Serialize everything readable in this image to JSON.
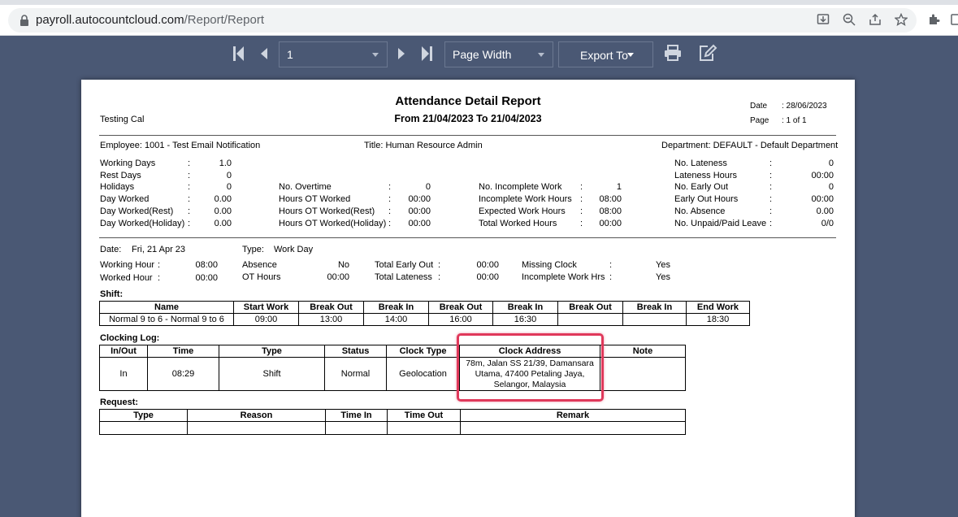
{
  "browser": {
    "url_host": "payroll.autocountcloud.com",
    "url_path": "/Report/Report"
  },
  "toolbar": {
    "page_value": "1",
    "zoom_value": "Page Width",
    "export_label": "Export To"
  },
  "report": {
    "title": "Attendance Detail Report",
    "subtitle": "From 21/04/2023 To 21/04/2023",
    "company": "Testing Cal",
    "date_label": "Date",
    "date_value": ": 28/06/2023",
    "page_label": "Page",
    "page_value": ": 1 of 1",
    "employee": "Employee:  1001 - Test Email Notification",
    "title_field": "Title: Human Resource Admin",
    "department": "Department: DEFAULT - Default Department",
    "summary_col1": [
      {
        "label": "Working Days",
        "value": "1.0"
      },
      {
        "label": "Rest Days",
        "value": "0"
      },
      {
        "label": "Holidays",
        "value": "0"
      },
      {
        "label": "Day Worked",
        "value": "0.00"
      },
      {
        "label": "Day Worked(Rest)",
        "value": "0.00"
      },
      {
        "label": "Day Worked(Holiday)",
        "value": "0.00"
      }
    ],
    "summary_col2": [
      {
        "label": "No. Overtime",
        "value": "0"
      },
      {
        "label": "Hours OT Worked",
        "value": "00:00"
      },
      {
        "label": "Hours OT Worked(Rest)",
        "value": "00:00"
      },
      {
        "label": "Hours OT Worked(Holiday)",
        "value": "00:00"
      }
    ],
    "summary_col3": [
      {
        "label": "No. Incomplete Work",
        "value": "1"
      },
      {
        "label": "Incomplete Work Hours",
        "value": "08:00"
      },
      {
        "label": "Expected Work Hours",
        "value": "08:00"
      },
      {
        "label": "Total Worked Hours",
        "value": "00:00"
      }
    ],
    "summary_col4": [
      {
        "label": "No. Lateness",
        "value": "0"
      },
      {
        "label": "Lateness Hours",
        "value": "00:00"
      },
      {
        "label": "No. Early Out",
        "value": "0"
      },
      {
        "label": "Early Out Hours",
        "value": "00:00"
      },
      {
        "label": "No. Absence",
        "value": "0.00"
      },
      {
        "label": "No. Unpaid/Paid Leave",
        "value": "0/0"
      }
    ],
    "day": {
      "date_label": "Date:",
      "date_value": "Fri, 21 Apr 23",
      "type_label": "Type:",
      "type_value": "Work Day",
      "working_hour_label": "Working Hour",
      "working_hour_value": "08:00",
      "worked_hour_label": "Worked Hour",
      "worked_hour_value": "00:00",
      "absence_label": "Absence",
      "absence_value": "No",
      "ot_hours_label": "OT Hours",
      "ot_hours_value": "00:00",
      "total_early_out_label": "Total Early Out",
      "total_early_out_value": "00:00",
      "total_lateness_label": "Total Lateness",
      "total_lateness_value": "00:00",
      "missing_clock_label": "Missing Clock",
      "missing_clock_value": "Yes",
      "incomplete_hrs_label": "Incomplete Work Hrs",
      "incomplete_hrs_value": "Yes"
    },
    "shift": {
      "heading": "Shift:",
      "headers": [
        "Name",
        "Start Work",
        "Break Out",
        "Break In",
        "Break Out",
        "Break In",
        "Break Out",
        "Break In",
        "End Work"
      ],
      "row": [
        "Normal 9 to 6  - Normal 9 to 6",
        "09:00",
        "13:00",
        "14:00",
        "16:00",
        "16:30",
        "",
        "",
        "18:30"
      ]
    },
    "clocking": {
      "heading": "Clocking Log:",
      "headers": [
        "In/Out",
        "Time",
        "Type",
        "Status",
        "Clock Type",
        "Clock Address",
        "Note"
      ],
      "row": [
        "In",
        "08:29",
        "Shift",
        "Normal",
        "Geolocation",
        "78m, Jalan SS 21/39, Damansara Utama, 47400 Petaling Jaya, Selangor, Malaysia",
        ""
      ]
    },
    "request": {
      "heading": "Request:",
      "headers": [
        "Type",
        "Reason",
        "Time In",
        "Time Out",
        "Remark"
      ]
    }
  },
  "colors": {
    "viewer_background": "#4a5874",
    "highlight": "#e0395b"
  }
}
